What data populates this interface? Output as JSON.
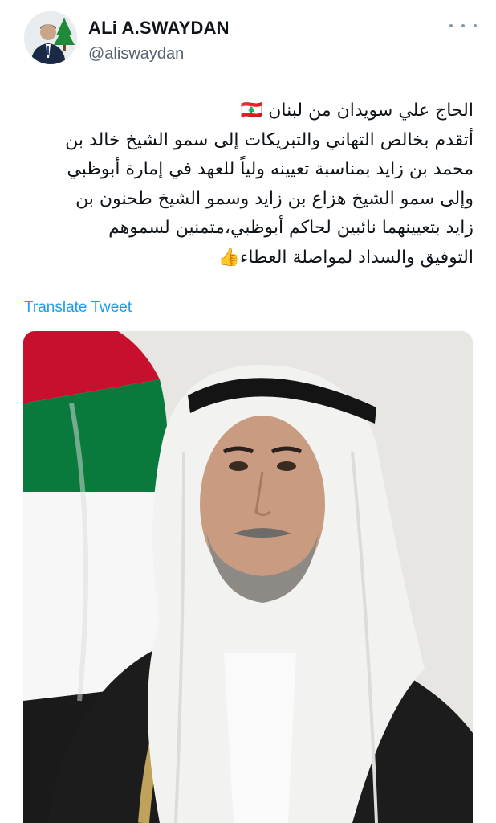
{
  "author": {
    "display_name": "ALi A.SWAYDAN",
    "handle": "@aliswaydan",
    "avatar_icon": "profile-photo-with-cedar"
  },
  "header": {
    "more_icon": "more-dots-icon"
  },
  "tweet": {
    "lines": [
      "الحاج علي سويدان من لبنان 🇱🇧",
      "أتقدم بخالص التهاني والتبريكات إلى سمو الشيخ خالد بن",
      "محمد بن زايد بمناسبة تعيينه ولياً للعهد في إمارة أبوظبي",
      "وإلى سمو الشيخ هزاع بن زايد وسمو الشيخ طحنون بن",
      "زايد بتعيينهما نائبين لحاكم أبوظبي،متمنين لسموهم",
      "التوفيق والسداد لمواصلة العطاء👍"
    ]
  },
  "translate_label": "Translate Tweet",
  "colors": {
    "link": "#1d9bf0",
    "handle": "#536471",
    "flag_red": "#c8102e",
    "flag_green": "#00843d",
    "flag_white": "#ffffff",
    "flag_black": "#000000"
  },
  "media": {
    "icon": "portrait-photo"
  }
}
